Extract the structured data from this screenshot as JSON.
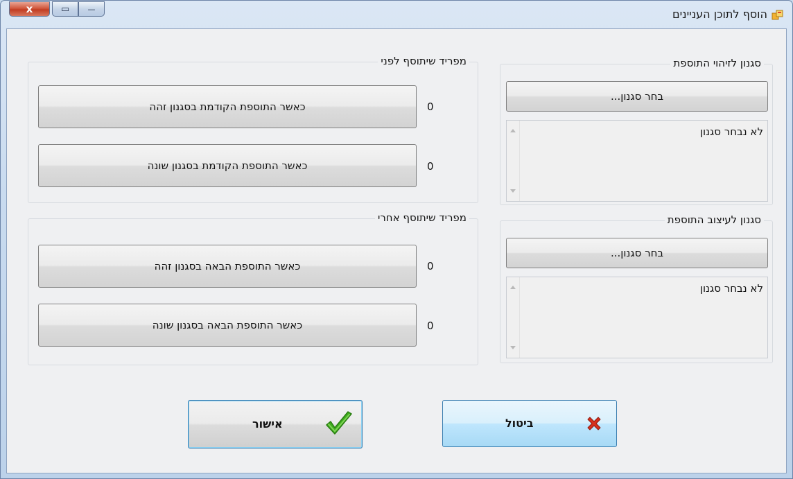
{
  "window": {
    "title": "הוסף לתוכן העניינים",
    "close_glyph": "x",
    "maximize_glyph": "▭",
    "minimize_glyph": "—"
  },
  "style_identify": {
    "label": "סגנון לזיהוי התוספת",
    "choose_button": "בחר סגנון...",
    "value": "לא נבחר סגנון"
  },
  "style_format": {
    "label": "סגנון לעיצוב התוספת",
    "choose_button": "בחר סגנון...",
    "value": "לא נבחר סגנון"
  },
  "separator_before": {
    "label": "מפריד שיתוסף לפני",
    "same_style_button": "כאשר התוספת הקודמת בסגנון זהה",
    "same_style_value": "0",
    "diff_style_button": "כאשר התוספת הקודמת בסגנון שונה",
    "diff_style_value": "0"
  },
  "separator_after": {
    "label": "מפריד שיתוסף אחרי",
    "same_style_button": "כאשר התוספת הבאה בסגנון זהה",
    "same_style_value": "0",
    "diff_style_button": "כאשר התוספת הבאה בסגנון שונה",
    "diff_style_value": "0"
  },
  "actions": {
    "ok_label": "אישור",
    "cancel_label": "ביטול"
  },
  "icons": {
    "ok": "green-checkmark-icon",
    "cancel": "red-x-icon",
    "app": "toc-app-icon"
  },
  "colors": {
    "ok_check": "#3fae1e",
    "cancel_x": "#d6301c",
    "close_button": "#c9452a"
  }
}
